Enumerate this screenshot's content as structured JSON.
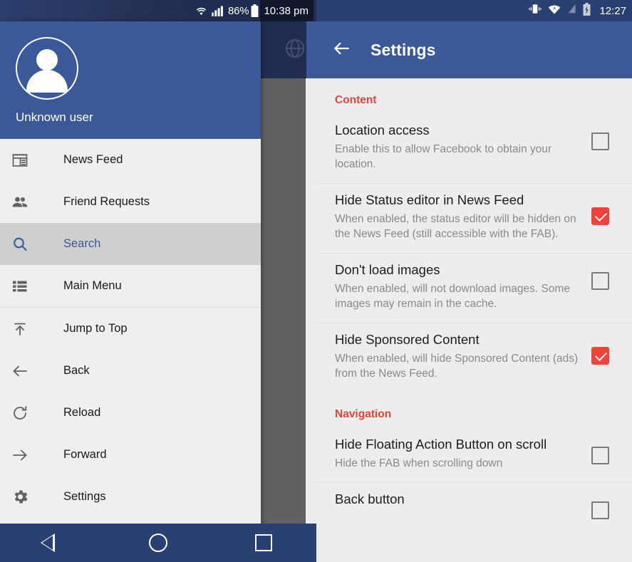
{
  "left_phone": {
    "status_bar": {
      "icons": [
        "wifi-icon",
        "cell-signal-icon",
        "battery-icon"
      ],
      "battery_percent": "86%",
      "time": "10:38 pm"
    },
    "behind_toolbar": {
      "icon": "globe-icon"
    },
    "drawer": {
      "header": {
        "avatar": "person-avatar-icon",
        "username": "Unknown user"
      },
      "groups": [
        {
          "items": [
            {
              "icon": "newspaper-icon",
              "label": "News Feed",
              "selected": false
            },
            {
              "icon": "people-icon",
              "label": "Friend Requests",
              "selected": false
            },
            {
              "icon": "search-icon",
              "label": "Search",
              "selected": true
            },
            {
              "icon": "list-icon",
              "label": "Main Menu",
              "selected": false
            }
          ]
        },
        {
          "items": [
            {
              "icon": "jump-to-top-icon",
              "label": "Jump to Top",
              "selected": false
            },
            {
              "icon": "arrow-left-icon",
              "label": "Back",
              "selected": false
            },
            {
              "icon": "reload-icon",
              "label": "Reload",
              "selected": false
            },
            {
              "icon": "arrow-right-icon",
              "label": "Forward",
              "selected": false
            },
            {
              "icon": "gear-icon",
              "label": "Settings",
              "selected": false
            }
          ]
        }
      ]
    },
    "navbar": {
      "back": "nav-back-triangle",
      "home": "nav-home-circle",
      "recents": "nav-recents-square"
    }
  },
  "right_phone": {
    "status_bar": {
      "icons": [
        "vibrate-icon",
        "wifi-icon",
        "cell-signal-off-icon",
        "battery-charging-icon"
      ],
      "time": "12:27"
    },
    "app_bar": {
      "back_icon": "arrow-back-icon",
      "title": "Settings"
    },
    "sections": [
      {
        "header": "Content",
        "rows": [
          {
            "title": "Location access",
            "subtitle": "Enable this to allow Facebook to obtain your location.",
            "checked": false
          },
          {
            "title": "Hide Status editor in News Feed",
            "subtitle": "When enabled, the status editor will be hidden on the News Feed (still accessible with the FAB).",
            "checked": true
          },
          {
            "title": "Don't load images",
            "subtitle": "When enabled, will not download images. Some images may remain in the cache.",
            "checked": false
          },
          {
            "title": "Hide Sponsored Content",
            "subtitle": "When enabled, will hide Sponsored Content (ads) from the News Feed.",
            "checked": true
          }
        ]
      },
      {
        "header": "Navigation",
        "rows": [
          {
            "title": "Hide Floating Action Button on scroll",
            "subtitle": "Hide the FAB when scrolling down",
            "checked": false
          },
          {
            "title": "Back button",
            "subtitle": "",
            "checked": false
          }
        ]
      }
    ]
  },
  "colors": {
    "brand_blue": "#3b5998",
    "dark_blue": "#2b4072",
    "status_dark": "#1f2d52",
    "accent_red": "#e8453c",
    "checkbox_red": "#f4423a",
    "scrim_gray": "#616161",
    "panel_gray": "#eceded"
  }
}
